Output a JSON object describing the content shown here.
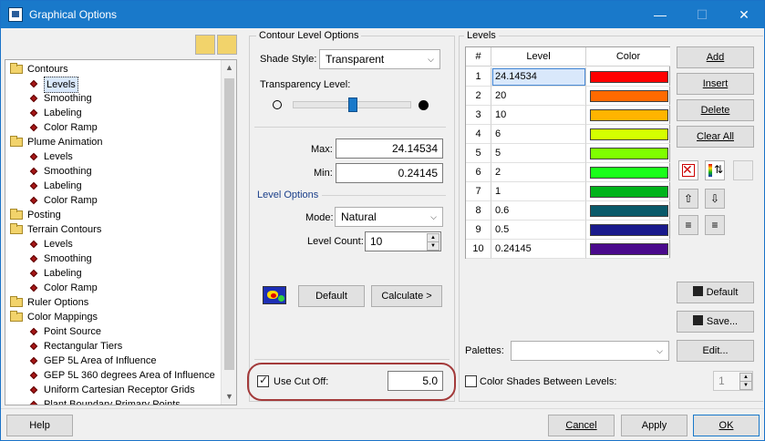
{
  "window": {
    "title": "Graphical Options"
  },
  "tree": {
    "items": [
      {
        "label": "Contours",
        "type": "folder",
        "level": 0
      },
      {
        "label": "Levels",
        "type": "leaf",
        "level": 1,
        "selected": true
      },
      {
        "label": "Smoothing",
        "type": "leaf",
        "level": 1
      },
      {
        "label": "Labeling",
        "type": "leaf",
        "level": 1
      },
      {
        "label": "Color Ramp",
        "type": "leaf",
        "level": 1
      },
      {
        "label": "Plume Animation",
        "type": "folder",
        "level": 0
      },
      {
        "label": "Levels",
        "type": "leaf",
        "level": 1
      },
      {
        "label": "Smoothing",
        "type": "leaf",
        "level": 1
      },
      {
        "label": "Labeling",
        "type": "leaf",
        "level": 1
      },
      {
        "label": "Color Ramp",
        "type": "leaf",
        "level": 1
      },
      {
        "label": "Posting",
        "type": "folder",
        "level": 0
      },
      {
        "label": "Terrain Contours",
        "type": "folder",
        "level": 0
      },
      {
        "label": "Levels",
        "type": "leaf",
        "level": 1
      },
      {
        "label": "Smoothing",
        "type": "leaf",
        "level": 1
      },
      {
        "label": "Labeling",
        "type": "leaf",
        "level": 1
      },
      {
        "label": "Color Ramp",
        "type": "leaf",
        "level": 1
      },
      {
        "label": "Ruler Options",
        "type": "folder",
        "level": 0
      },
      {
        "label": "Color Mappings",
        "type": "folder",
        "level": 0
      },
      {
        "label": "Point Source",
        "type": "leaf",
        "level": 1
      },
      {
        "label": "Rectangular Tiers",
        "type": "leaf",
        "level": 1
      },
      {
        "label": "GEP 5L Area of Influence",
        "type": "leaf",
        "level": 1
      },
      {
        "label": "GEP 5L 360 degrees Area of Influence",
        "type": "leaf",
        "level": 1
      },
      {
        "label": "Uniform Cartesian Receptor Grids",
        "type": "leaf",
        "level": 1
      },
      {
        "label": "Plant Boundary Primary Points",
        "type": "leaf",
        "level": 1
      }
    ]
  },
  "contour": {
    "group_title": "Contour Level Options",
    "shade_style_label": "Shade Style:",
    "shade_style_value": "Transparent",
    "transparency_label": "Transparency Level:",
    "transparency_value": 0.25,
    "max_label": "Max:",
    "max_value": "24.14534",
    "min_label": "Min:",
    "min_value": "0.24145",
    "level_options_title": "Level Options",
    "mode_label": "Mode:",
    "mode_value": "Natural",
    "level_count_label": "Level Count:",
    "level_count_value": "10",
    "default_button": "Default",
    "calculate_button": "Calculate >",
    "use_cutoff_label": "Use Cut Off:",
    "use_cutoff_checked": true,
    "cutoff_value": "5.0"
  },
  "levels": {
    "group_title": "Levels",
    "col_index": "#",
    "col_level": "Level",
    "col_color": "Color",
    "rows": [
      {
        "num": "1",
        "level": "24.14534",
        "color": "#ff0000"
      },
      {
        "num": "2",
        "level": "20",
        "color": "#ff6a00"
      },
      {
        "num": "3",
        "level": "10",
        "color": "#ffb400"
      },
      {
        "num": "4",
        "level": "6",
        "color": "#d4ff00"
      },
      {
        "num": "5",
        "level": "5",
        "color": "#7fff00"
      },
      {
        "num": "6",
        "level": "2",
        "color": "#1aff1a"
      },
      {
        "num": "7",
        "level": "1",
        "color": "#00b31a"
      },
      {
        "num": "8",
        "level": "0.6",
        "color": "#0a5a6a"
      },
      {
        "num": "9",
        "level": "0.5",
        "color": "#1a1a8c"
      },
      {
        "num": "10",
        "level": "0.24145",
        "color": "#4a0a8c"
      }
    ],
    "palettes_label": "Palettes:",
    "palettes_value": "",
    "color_shades_label": "Color Shades Between Levels:",
    "color_shades_checked": false,
    "shades_value": "1"
  },
  "side_buttons": {
    "add": "Add",
    "insert": "Insert",
    "delete": "Delete",
    "clear_all": "Clear All",
    "default": "Default",
    "save": "Save...",
    "edit": "Edit..."
  },
  "footer": {
    "help": "Help",
    "cancel": "Cancel",
    "apply": "Apply",
    "ok": "OK"
  }
}
